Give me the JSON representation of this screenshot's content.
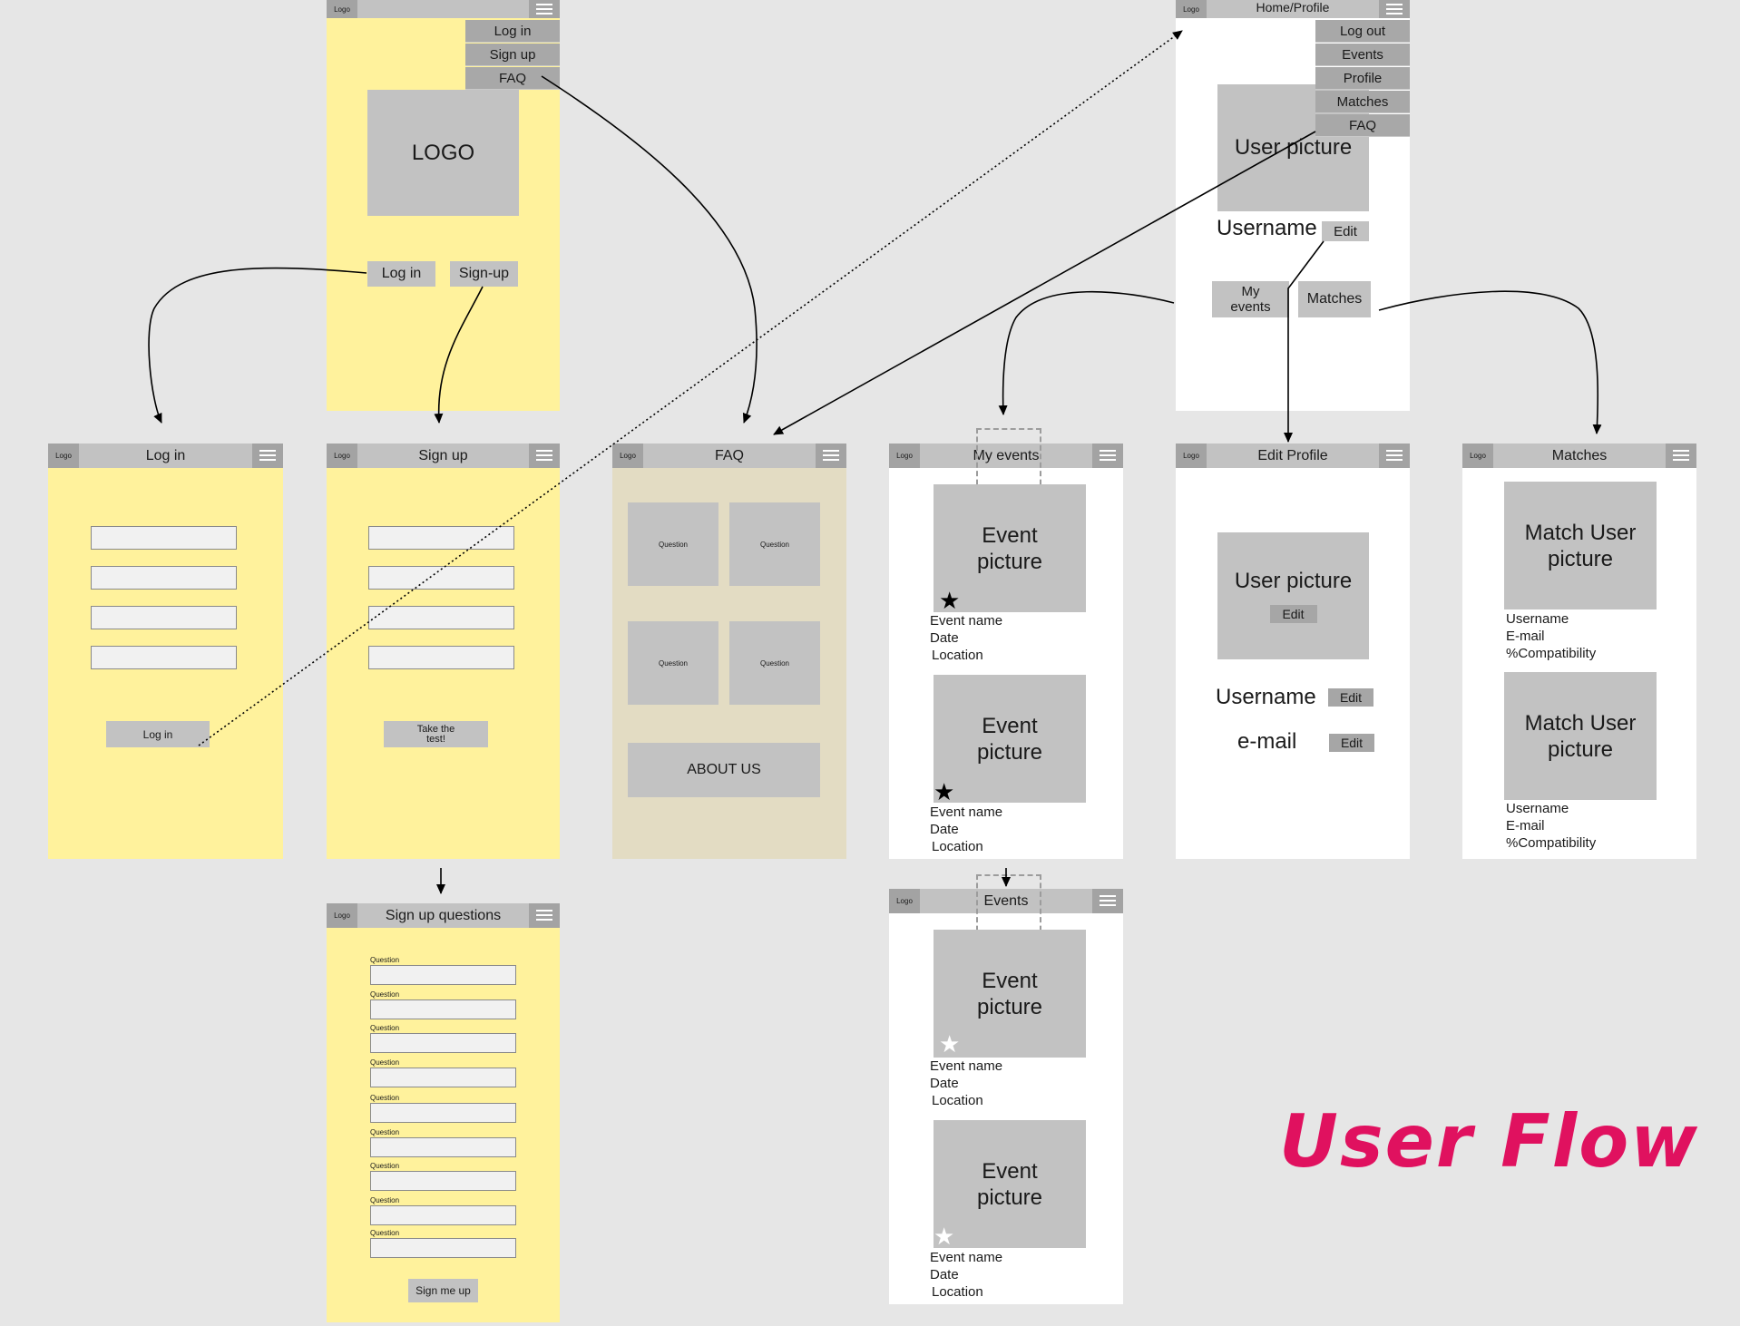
{
  "brand": "User Flow",
  "header_logo": "Logo",
  "landing": {
    "menu": [
      "Log in",
      "Sign up",
      "FAQ"
    ],
    "logo": "LOGO",
    "login_button": "Log in",
    "signup_button": "Sign-up"
  },
  "login": {
    "title": "Log in",
    "button": "Log in"
  },
  "signup": {
    "title": "Sign up",
    "button": "Take the\ntest!"
  },
  "signup_questions": {
    "title": "Sign up questions",
    "question_label": "Question",
    "questions": [
      "Question",
      "Question",
      "Question",
      "Question",
      "Question",
      "Question",
      "Question",
      "Question",
      "Question"
    ],
    "button": "Sign me up"
  },
  "faq": {
    "title": "FAQ",
    "questions": [
      "Question",
      "Question",
      "Question",
      "Question"
    ],
    "about": "ABOUT US"
  },
  "home": {
    "title": "Home/Profile",
    "menu": [
      "Log out",
      "Events",
      "Profile",
      "Matches",
      "FAQ"
    ],
    "user_picture": "User picture",
    "username": "Username",
    "edit": "Edit",
    "my_events": "My\nevents",
    "matches": "Matches"
  },
  "my_events": {
    "title": "My events",
    "events": [
      {
        "picture": "Event\npicture",
        "name": "Event name",
        "date": "Date",
        "location": "Location",
        "starred": true
      },
      {
        "picture": "Event\npicture",
        "name": "Event name",
        "date": "Date",
        "location": "Location",
        "starred": true
      }
    ]
  },
  "events": {
    "title": "Events",
    "events": [
      {
        "picture": "Event\npicture",
        "name": "Event name",
        "date": "Date",
        "location": "Location",
        "starred": false
      },
      {
        "picture": "Event\npicture",
        "name": "Event name",
        "date": "Date",
        "location": "Location",
        "starred": false
      }
    ]
  },
  "edit_profile": {
    "title": "Edit Profile",
    "user_picture": "User picture",
    "edit": "Edit",
    "username": "Username",
    "email": "e-mail"
  },
  "matches": {
    "title": "Matches",
    "items": [
      {
        "picture": "Match User\npicture",
        "username": "Username",
        "email": "E-mail",
        "compat": "%Compatibility"
      },
      {
        "picture": "Match User\npicture",
        "username": "Username",
        "email": "E-mail",
        "compat": "%Compatibility"
      }
    ]
  }
}
